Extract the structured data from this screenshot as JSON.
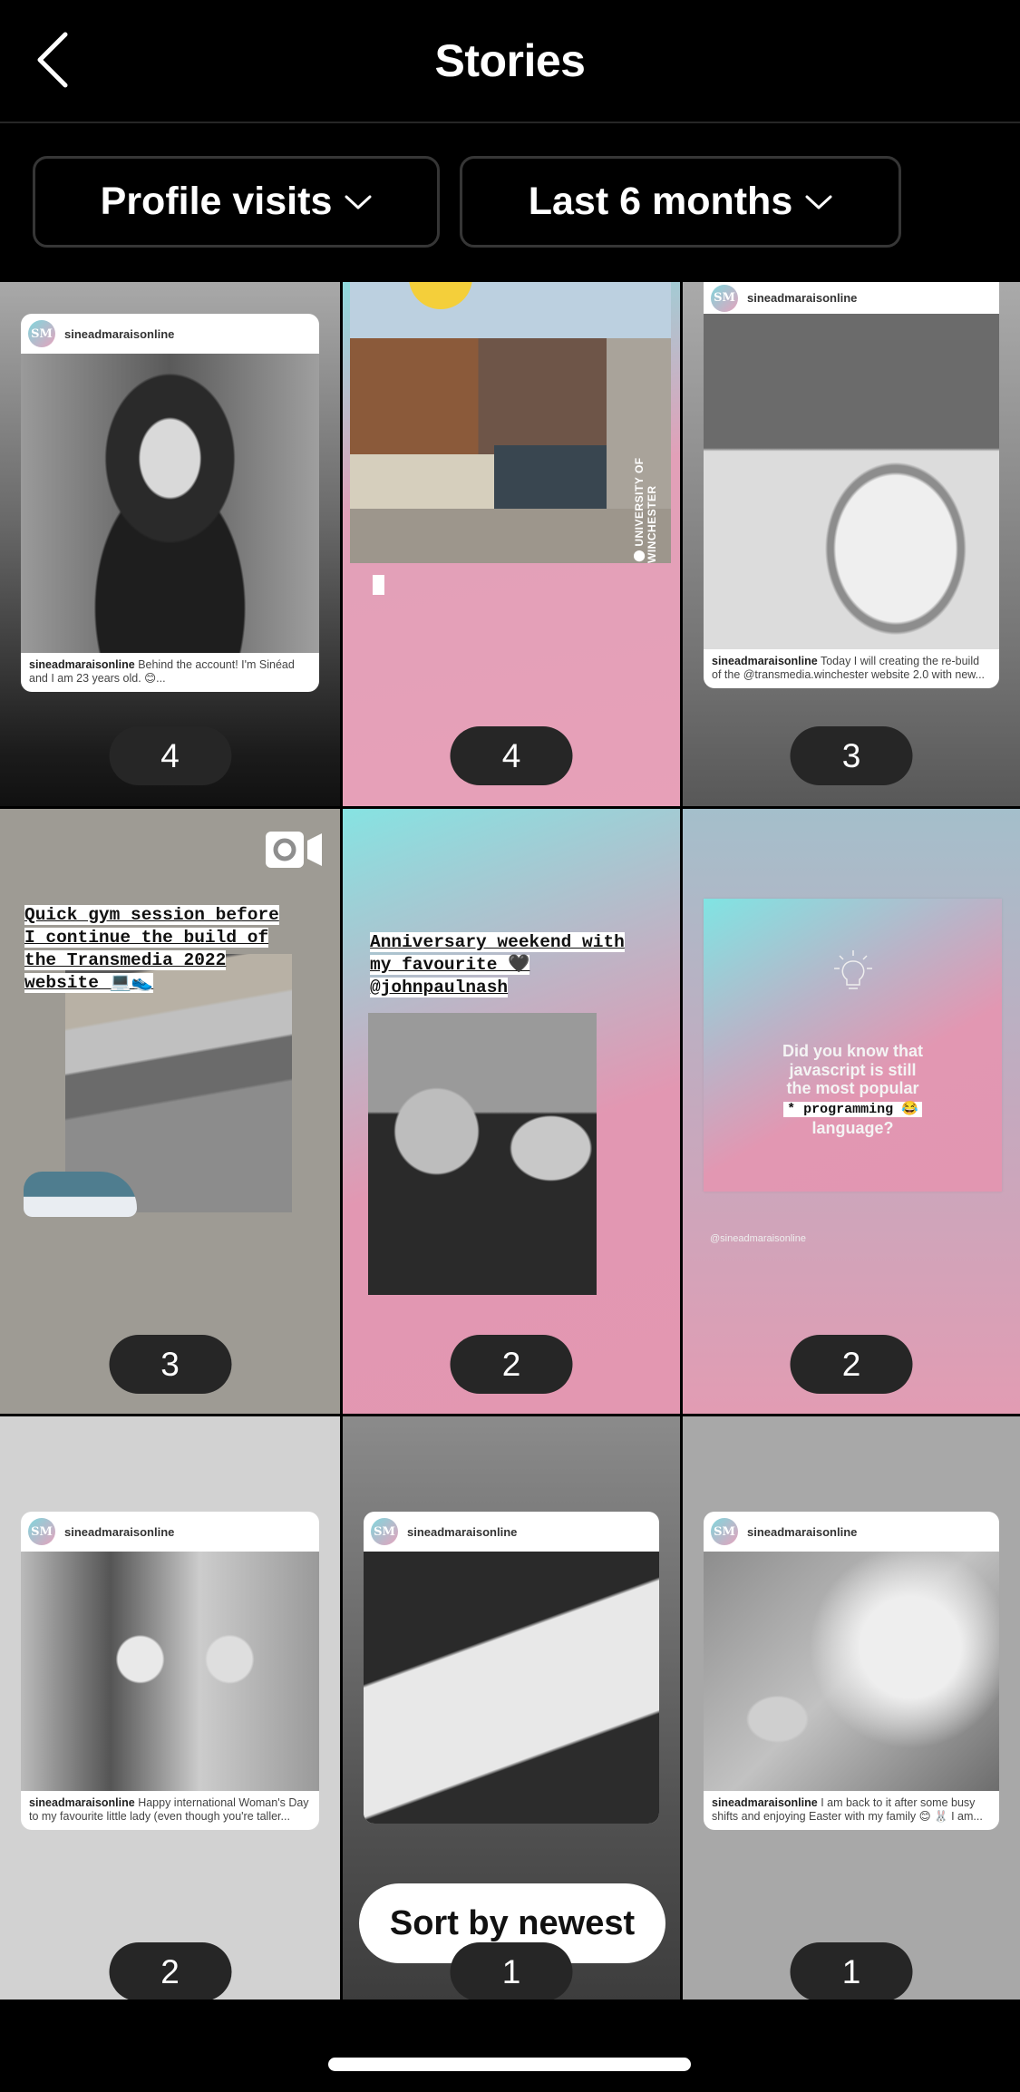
{
  "header": {
    "title": "Stories",
    "back_icon": "chevron-left-icon"
  },
  "filters": {
    "metric": {
      "label": "Profile visits",
      "icon": "chevron-down-icon"
    },
    "period": {
      "label": "Last 6 months",
      "icon": "chevron-down-icon"
    }
  },
  "stories": [
    {
      "count": "4",
      "type": "shared-post",
      "post": {
        "avatar": "SM",
        "username": "sineadmaraisonline",
        "caption_user": "sineadmaraisonline",
        "caption_text": " Behind the account! I'm Sinéad and I am 23 years old. 😊..."
      }
    },
    {
      "count": "4",
      "type": "photo",
      "location_sticker": "⬤ UNIVERSITY OF WINCHESTER"
    },
    {
      "count": "3",
      "type": "shared-post",
      "post": {
        "avatar": "SM",
        "username": "sineadmaraisonline",
        "caption_user": "sineadmaraisonline",
        "caption_text": " Today I will creating the re-build of the @transmedia.winchester website 2.0 with new..."
      }
    },
    {
      "count": "3",
      "type": "video",
      "text": [
        "Quick gym session before",
        "I continue the build of",
        "the Transmedia 2022",
        "website 💻👟"
      ]
    },
    {
      "count": "2",
      "type": "photo",
      "text": [
        "Anniversary weekend with",
        "my favourite 🖤",
        "@johnpaulnash"
      ]
    },
    {
      "count": "2",
      "type": "shared-post",
      "card_lines": [
        "Did you know that",
        "javascript is still",
        "the most popular"
      ],
      "card_highlight": "* programming 😂",
      "card_last_line": "language?",
      "handle": "@sineadmaraisonline"
    },
    {
      "count": "2",
      "type": "shared-post",
      "post": {
        "avatar": "SM",
        "username": "sineadmaraisonline",
        "caption_user": "sineadmaraisonline",
        "caption_text": " Happy international Woman's Day to my favourite little lady (even though you're taller..."
      }
    },
    {
      "count": "1",
      "type": "shared-post",
      "post": {
        "avatar": "SM",
        "username": "sineadmaraisonline"
      }
    },
    {
      "count": "1",
      "type": "shared-post",
      "post": {
        "avatar": "SM",
        "username": "sineadmaraisonline",
        "caption_user": "sineadmaraisonline",
        "caption_text": " I  am back to it after some busy shifts and enjoying Easter with my family 😊 🐰 I am..."
      }
    }
  ],
  "sort_button": {
    "label": "Sort by newest"
  }
}
